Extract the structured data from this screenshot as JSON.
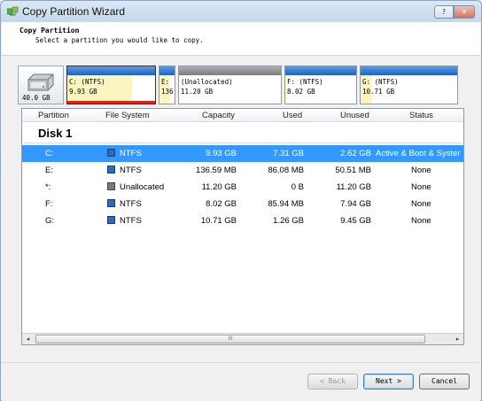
{
  "window": {
    "title": "Copy Partition Wizard",
    "help_label": "?",
    "close_label": "✕"
  },
  "header": {
    "title": "Copy Partition",
    "subtitle": "Select a partition you would like to copy."
  },
  "disk_map": {
    "disk_size": "40.0 GB",
    "partitions": [
      {
        "line1": "C: (NTFS)",
        "line2": "9.93 GB",
        "used_fraction": 0.74,
        "selected": true
      },
      {
        "line1": "E: (",
        "line2": "136",
        "used_fraction": 0.63,
        "selected": false
      },
      {
        "line1": "(Unallocated)",
        "line2": "11.20 GB",
        "used_fraction": 0,
        "selected": false
      },
      {
        "line1": "F: (NTFS)",
        "line2": "8.02 GB",
        "used_fraction": 0.01,
        "selected": false
      },
      {
        "line1": "G: (NTFS)",
        "line2": "10.71 GB",
        "used_fraction": 0.12,
        "selected": false
      }
    ]
  },
  "table": {
    "columns": [
      "Partition",
      "File System",
      "Capacity",
      "Used",
      "Unused",
      "Status"
    ],
    "disk_label": "Disk 1",
    "rows": [
      {
        "partition": "C:",
        "fs": "NTFS",
        "capacity": "9.93 GB",
        "used": "7.31 GB",
        "unused": "2.62 GB",
        "status": "Active & Boot & Syster",
        "selected": true
      },
      {
        "partition": "E:",
        "fs": "NTFS",
        "capacity": "136.59 MB",
        "used": "86.08 MB",
        "unused": "50.51 MB",
        "status": "None",
        "selected": false
      },
      {
        "partition": "*:",
        "fs": "Unallocated",
        "capacity": "11.20 GB",
        "used": "0 B",
        "unused": "11.20 GB",
        "status": "None",
        "selected": false
      },
      {
        "partition": "F:",
        "fs": "NTFS",
        "capacity": "8.02 GB",
        "used": "85.94 MB",
        "unused": "7.94 GB",
        "status": "None",
        "selected": false
      },
      {
        "partition": "G:",
        "fs": "NTFS",
        "capacity": "10.71 GB",
        "used": "1.26 GB",
        "unused": "9.45 GB",
        "status": "None",
        "selected": false
      }
    ]
  },
  "scrollbar": {
    "left_arrow": "◂",
    "right_arrow": "▸",
    "grip": "III"
  },
  "buttons": {
    "back": "< Back",
    "next": "Next >",
    "cancel": "Cancel"
  },
  "colors": {
    "selection": "#3399ff",
    "partition_cap": "#1e63c4",
    "used_space": "#fbf6c0",
    "selected_marker": "#e0201a"
  }
}
